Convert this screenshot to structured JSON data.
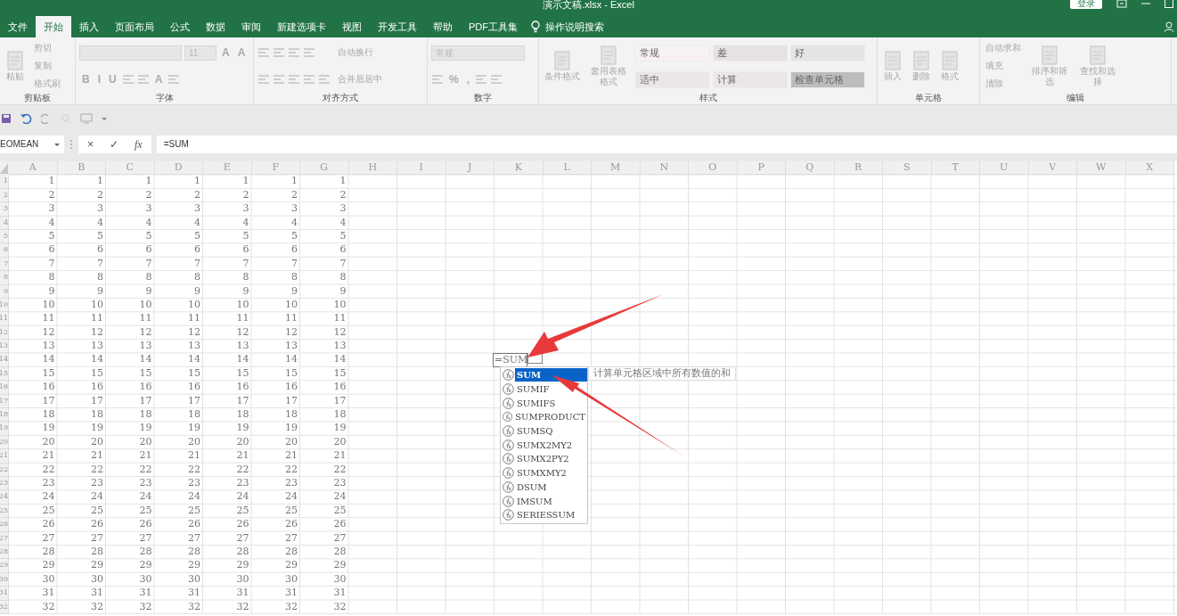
{
  "window": {
    "title": "演示文稿.xlsx  -  Excel",
    "signin": "登录"
  },
  "tabs": [
    {
      "label": "文件",
      "selected": false
    },
    {
      "label": "开始",
      "selected": true
    },
    {
      "label": "插入",
      "selected": false
    },
    {
      "label": "页面布局",
      "selected": false
    },
    {
      "label": "公式",
      "selected": false
    },
    {
      "label": "数据",
      "selected": false
    },
    {
      "label": "审阅",
      "selected": false
    },
    {
      "label": "新建选项卡",
      "selected": false
    },
    {
      "label": "视图",
      "selected": false
    },
    {
      "label": "开发工具",
      "selected": false
    },
    {
      "label": "帮助",
      "selected": false
    },
    {
      "label": "PDF工具集",
      "selected": false
    }
  ],
  "tell_me": "操作说明搜索",
  "ribbon": [
    {
      "label": "剪贴板",
      "columns": [
        [
          [
            {
              "kind": "large",
              "text": "粘贴"
            }
          ]
        ],
        [
          [
            {
              "kind": "button",
              "text": "剪切"
            }
          ],
          [
            {
              "kind": "button",
              "text": "复制"
            }
          ],
          [
            {
              "kind": "button",
              "text": "格式刷"
            }
          ]
        ]
      ]
    },
    {
      "label": "字体",
      "columns": [
        [
          [
            {
              "kind": "field"
            },
            {
              "kind": "field",
              "text": "11"
            },
            {
              "kind": "glyph",
              "text": "A"
            },
            {
              "kind": "glyph",
              "text": "A"
            }
          ],
          [
            {
              "kind": "glyph",
              "text": "B"
            },
            {
              "kind": "glyph",
              "text": "I"
            },
            {
              "kind": "glyph",
              "text": "U"
            },
            {
              "kind": "icon"
            },
            {
              "kind": "icon"
            },
            {
              "kind": "glyph",
              "text": "A"
            },
            {
              "kind": "icon"
            }
          ]
        ]
      ]
    },
    {
      "label": "对齐方式",
      "columns": [
        [
          [
            {
              "kind": "icon"
            },
            {
              "kind": "icon"
            },
            {
              "kind": "icon"
            },
            {
              "kind": "icon"
            }
          ],
          [
            {
              "kind": "icon"
            },
            {
              "kind": "icon"
            },
            {
              "kind": "icon"
            },
            {
              "kind": "icon"
            },
            {
              "kind": "icon"
            }
          ]
        ],
        [
          [
            {
              "kind": "button",
              "text": "自动换行"
            }
          ],
          [
            {
              "kind": "button",
              "text": "合并后居中"
            }
          ]
        ]
      ]
    },
    {
      "label": "数字",
      "columns": [
        [
          [
            {
              "kind": "field",
              "text": "常规"
            }
          ],
          [
            {
              "kind": "icon"
            },
            {
              "kind": "glyph",
              "text": "%"
            },
            {
              "kind": "glyph",
              "text": ","
            },
            {
              "kind": "icon"
            },
            {
              "kind": "icon"
            }
          ]
        ]
      ]
    },
    {
      "label": "样式",
      "columns": [
        [
          [
            {
              "kind": "large",
              "text": "条件格式"
            }
          ]
        ],
        [
          [
            {
              "kind": "large",
              "text": "套用表格格式"
            }
          ]
        ],
        [
          [
            {
              "kind": "tile",
              "text": "常规",
              "color": "#f7f1f4"
            },
            {
              "kind": "tile",
              "text": "差",
              "color": "#e6e1e3"
            },
            {
              "kind": "tile",
              "text": "好",
              "color": "#e6e3e3"
            }
          ],
          [
            {
              "kind": "tile",
              "text": "适中",
              "color": "#ebe6e8"
            },
            {
              "kind": "tile",
              "text": "计算",
              "color": "#ebe6e8"
            },
            {
              "kind": "tile",
              "text": "检查单元格",
              "color": "#bdbdbd"
            }
          ]
        ]
      ]
    },
    {
      "label": "单元格",
      "columns": [
        [
          [
            {
              "kind": "large",
              "text": "插入"
            }
          ]
        ],
        [
          [
            {
              "kind": "large",
              "text": "删除"
            }
          ]
        ],
        [
          [
            {
              "kind": "large",
              "text": "格式"
            }
          ]
        ]
      ]
    },
    {
      "label": "编辑",
      "columns": [
        [
          [
            {
              "kind": "button",
              "text": "自动求和"
            }
          ],
          [
            {
              "kind": "button",
              "text": "填充"
            }
          ],
          [
            {
              "kind": "button",
              "text": "清除"
            }
          ]
        ],
        [
          [
            {
              "kind": "large",
              "text": "排序和筛选"
            }
          ]
        ],
        [
          [
            {
              "kind": "large",
              "text": "查找和选择"
            }
          ]
        ]
      ]
    }
  ],
  "formula_bar": {
    "name_box": "EOMEAN",
    "cancel": "×",
    "enter": "✓",
    "fx": "fx",
    "formula": "=SUM"
  },
  "columns": [
    "A",
    "B",
    "C",
    "D",
    "E",
    "F",
    "G",
    "H",
    "I",
    "J",
    "K",
    "L",
    "M",
    "N",
    "O",
    "P",
    "Q",
    "R",
    "S",
    "T",
    "U",
    "V",
    "W",
    "X"
  ],
  "rows": [
    {
      "header": "1",
      "cells": [
        "1",
        "1",
        "1",
        "1",
        "1",
        "1",
        "1"
      ]
    },
    {
      "header": "2",
      "cells": [
        "2",
        "2",
        "2",
        "2",
        "2",
        "2",
        "2"
      ]
    },
    {
      "header": "3",
      "cells": [
        "3",
        "3",
        "3",
        "3",
        "3",
        "3",
        "3"
      ]
    },
    {
      "header": "4",
      "cells": [
        "4",
        "4",
        "4",
        "4",
        "4",
        "4",
        "4"
      ]
    },
    {
      "header": "5",
      "cells": [
        "5",
        "5",
        "5",
        "5",
        "5",
        "5",
        "5"
      ]
    },
    {
      "header": "6",
      "cells": [
        "6",
        "6",
        "6",
        "6",
        "6",
        "6",
        "6"
      ]
    },
    {
      "header": "7",
      "cells": [
        "7",
        "7",
        "7",
        "7",
        "7",
        "7",
        "7"
      ]
    },
    {
      "header": "8",
      "cells": [
        "8",
        "8",
        "8",
        "8",
        "8",
        "8",
        "8"
      ]
    },
    {
      "header": "9",
      "cells": [
        "9",
        "9",
        "9",
        "9",
        "9",
        "9",
        "9"
      ]
    },
    {
      "header": "10",
      "cells": [
        "10",
        "10",
        "10",
        "10",
        "10",
        "10",
        "10"
      ]
    },
    {
      "header": "11",
      "cells": [
        "11",
        "11",
        "11",
        "11",
        "11",
        "11",
        "11"
      ]
    },
    {
      "header": "12",
      "cells": [
        "12",
        "12",
        "12",
        "12",
        "12",
        "12",
        "12"
      ]
    },
    {
      "header": "13",
      "cells": [
        "13",
        "13",
        "13",
        "13",
        "13",
        "13",
        "13"
      ]
    },
    {
      "header": "14",
      "cells": [
        "14",
        "14",
        "14",
        "14",
        "14",
        "14",
        "14"
      ]
    },
    {
      "header": "15",
      "cells": [
        "15",
        "15",
        "15",
        "15",
        "15",
        "15",
        "15"
      ]
    },
    {
      "header": "16",
      "cells": [
        "16",
        "16",
        "16",
        "16",
        "16",
        "16",
        "16"
      ]
    },
    {
      "header": "17",
      "cells": [
        "17",
        "17",
        "17",
        "17",
        "17",
        "17",
        "17"
      ]
    },
    {
      "header": "18",
      "cells": [
        "18",
        "18",
        "18",
        "18",
        "18",
        "18",
        "18"
      ]
    },
    {
      "header": "19",
      "cells": [
        "19",
        "19",
        "19",
        "19",
        "19",
        "19",
        "19"
      ]
    },
    {
      "header": "20",
      "cells": [
        "20",
        "20",
        "20",
        "20",
        "20",
        "20",
        "20"
      ]
    },
    {
      "header": "21",
      "cells": [
        "21",
        "21",
        "21",
        "21",
        "21",
        "21",
        "21"
      ]
    },
    {
      "header": "22",
      "cells": [
        "22",
        "22",
        "22",
        "22",
        "22",
        "22",
        "22"
      ]
    },
    {
      "header": "23",
      "cells": [
        "23",
        "23",
        "23",
        "23",
        "23",
        "23",
        "23"
      ]
    },
    {
      "header": "24",
      "cells": [
        "24",
        "24",
        "24",
        "24",
        "24",
        "24",
        "24"
      ]
    },
    {
      "header": "25",
      "cells": [
        "25",
        "25",
        "25",
        "25",
        "25",
        "25",
        "25"
      ]
    },
    {
      "header": "26",
      "cells": [
        "26",
        "26",
        "26",
        "26",
        "26",
        "26",
        "26"
      ]
    },
    {
      "header": "27",
      "cells": [
        "27",
        "27",
        "27",
        "27",
        "27",
        "27",
        "27"
      ]
    },
    {
      "header": "28",
      "cells": [
        "28",
        "28",
        "28",
        "28",
        "28",
        "28",
        "28"
      ]
    },
    {
      "header": "29",
      "cells": [
        "29",
        "29",
        "29",
        "29",
        "29",
        "29",
        "29"
      ]
    },
    {
      "header": "30",
      "cells": [
        "30",
        "30",
        "30",
        "30",
        "30",
        "30",
        "30"
      ]
    },
    {
      "header": "31",
      "cells": [
        "31",
        "31",
        "31",
        "31",
        "31",
        "31",
        "31"
      ]
    },
    {
      "header": "32",
      "cells": [
        "32",
        "32",
        "32",
        "32",
        "32",
        "32",
        "32"
      ]
    }
  ],
  "editor": {
    "text": "=SUM",
    "suggestions": [
      {
        "label": "SUM",
        "selected": true
      },
      {
        "label": "SUMIF",
        "selected": false
      },
      {
        "label": "SUMIFS",
        "selected": false
      },
      {
        "label": "SUMPRODUCT",
        "selected": false
      },
      {
        "label": "SUMSQ",
        "selected": false
      },
      {
        "label": "SUMX2MY2",
        "selected": false
      },
      {
        "label": "SUMX2PY2",
        "selected": false
      },
      {
        "label": "SUMXMY2",
        "selected": false
      },
      {
        "label": "DSUM",
        "selected": false
      },
      {
        "label": "IMSUM",
        "selected": false
      },
      {
        "label": "SERIESSUM",
        "selected": false
      }
    ],
    "tooltip": "计算单元格区域中所有数值的和"
  }
}
